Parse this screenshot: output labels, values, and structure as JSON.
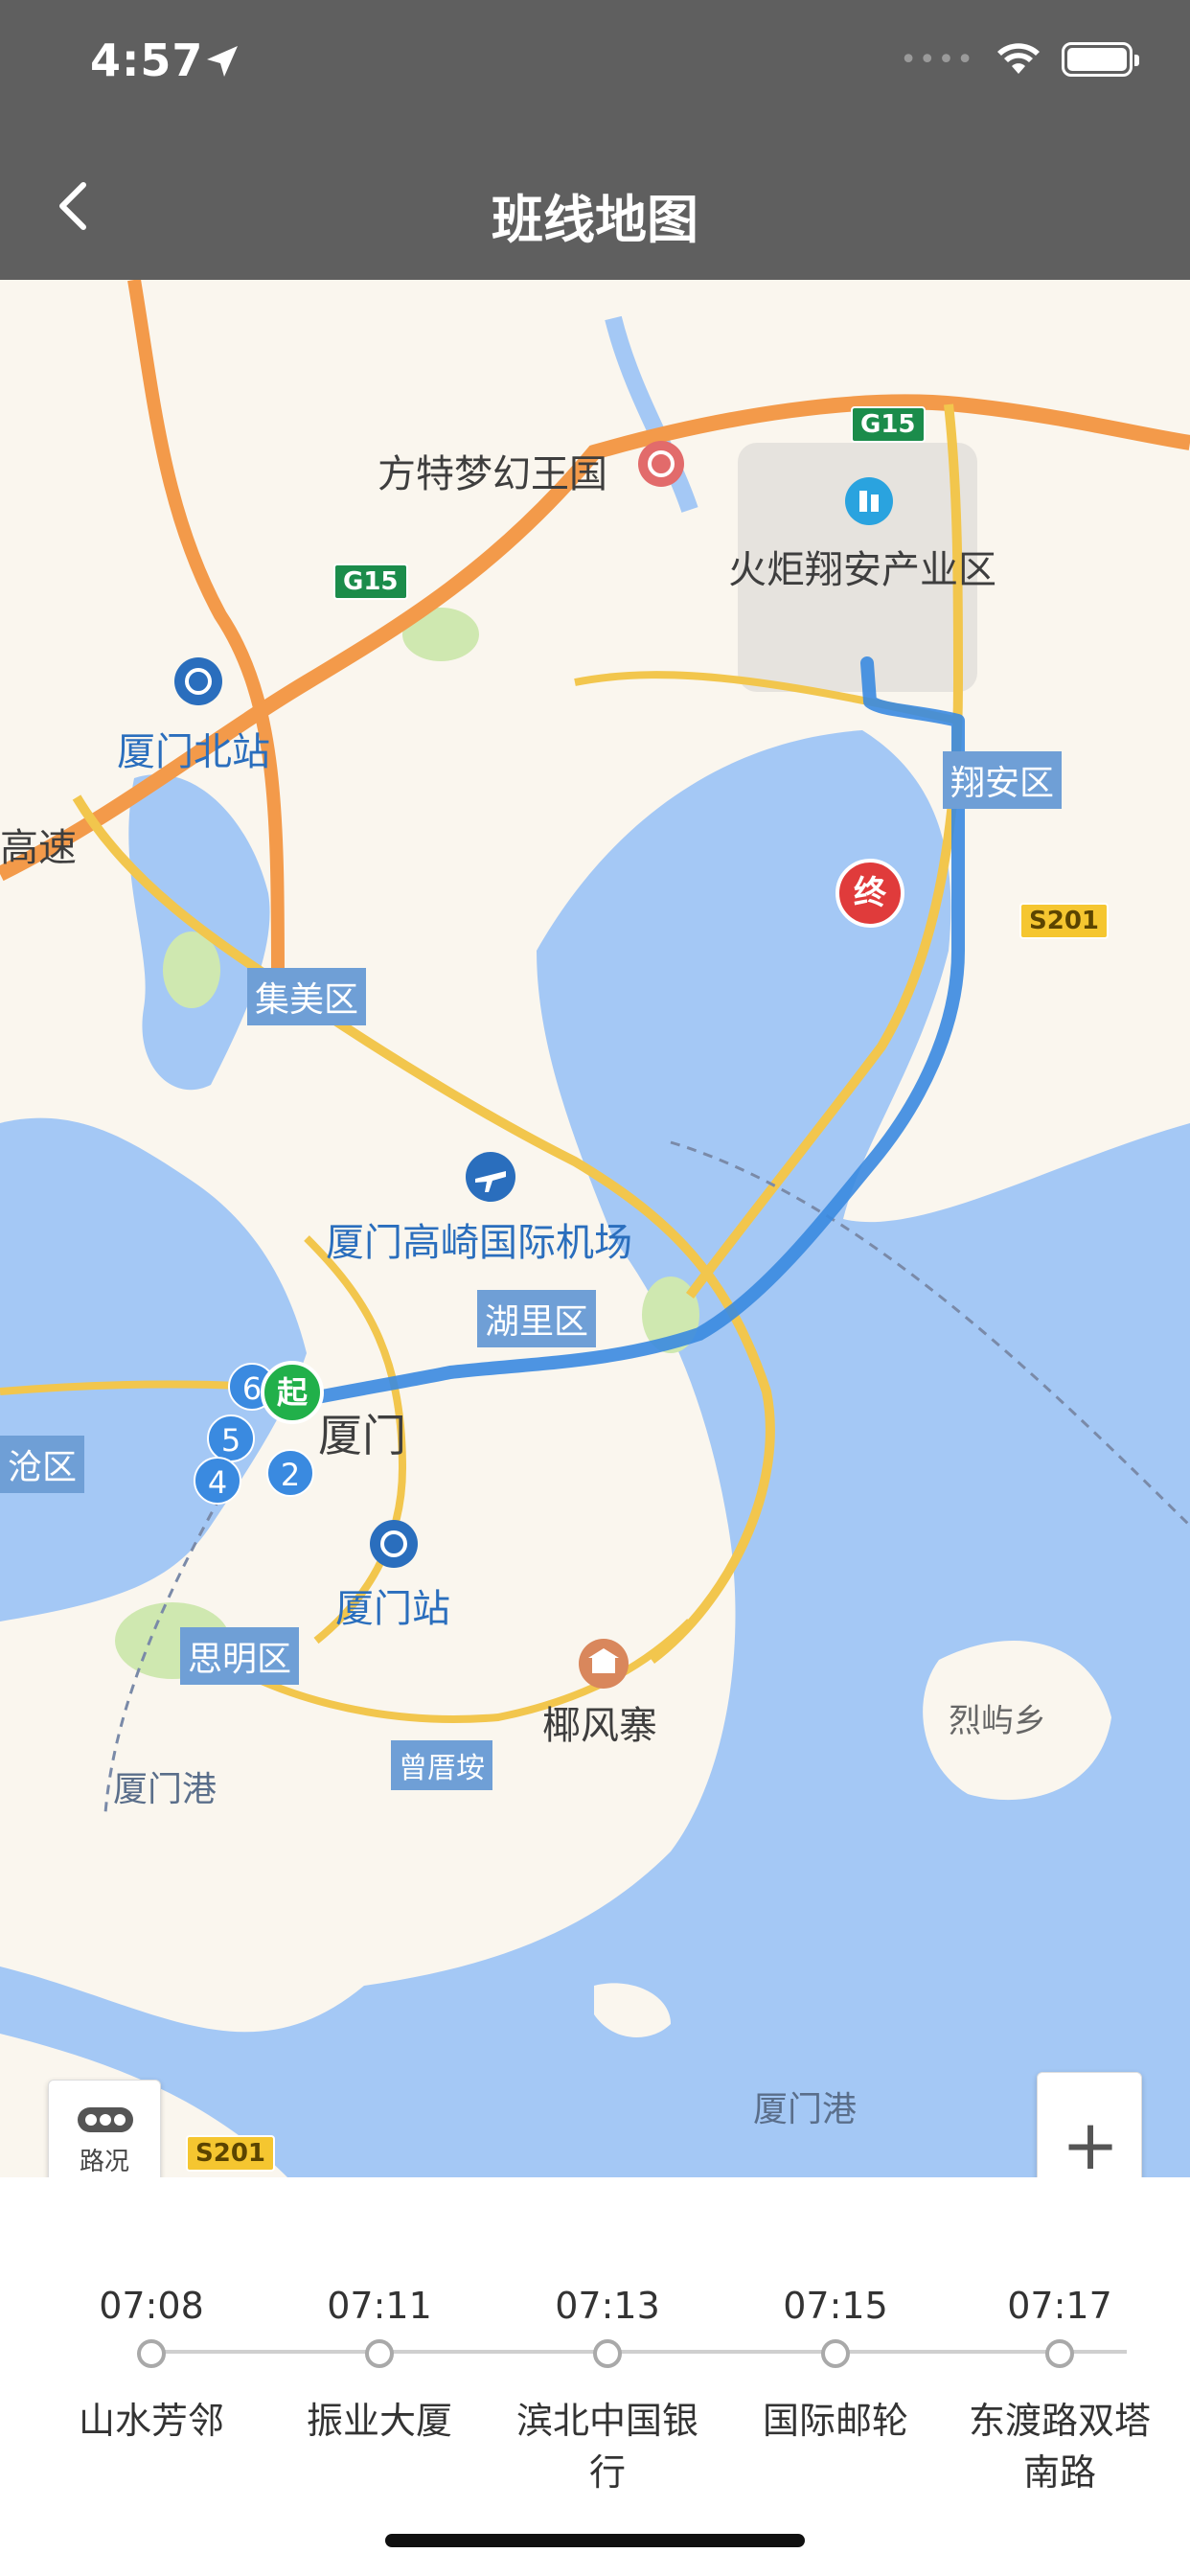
{
  "status_bar": {
    "time": "4:57"
  },
  "nav": {
    "title": "班线地图"
  },
  "map": {
    "labels": {
      "fangte": "方特梦幻王国",
      "huoju": "火炬翔安产业区",
      "xiamen_north": "厦门北站",
      "gaosu": "高速",
      "jimei": "集美区",
      "xiangan": "翔安区",
      "airport": "厦门高崎国际机场",
      "huli": "湖里区",
      "xiamen": "厦门",
      "cangqu": "沧区",
      "xiamen_station": "厦门站",
      "siming": "思明区",
      "yefengzhai": "椰风寨",
      "zengcuoan": "曾厝垵",
      "xiamen_port_left": "厦门港",
      "xiamen_port_bottom": "厦门港",
      "lieyu": "烈屿乡"
    },
    "shields": {
      "g15_top": "G15",
      "g15_left": "G15",
      "s201_right": "S201",
      "s201_bottom": "S201"
    },
    "pins": {
      "start": "起",
      "end": "终"
    },
    "stop_markers": [
      "6",
      "5",
      "4",
      "2"
    ],
    "controls": {
      "traffic_label": "路况",
      "zoom_in": "+",
      "zoom_out": "−"
    }
  },
  "timeline": {
    "stops": [
      {
        "time": "07:08",
        "name": "山水芳邻"
      },
      {
        "time": "07:11",
        "name": "振业大厦"
      },
      {
        "time": "07:13",
        "name": "滨北中国银行"
      },
      {
        "time": "07:15",
        "name": "国际邮轮"
      },
      {
        "time": "07:17",
        "name": "东渡路双塔南路"
      }
    ]
  },
  "colors": {
    "header_bg": "#5f5f5f",
    "route": "#3a8ae0",
    "start_pin": "#21b04a",
    "end_pin": "#e03b3b",
    "water": "#a4c8f5"
  }
}
